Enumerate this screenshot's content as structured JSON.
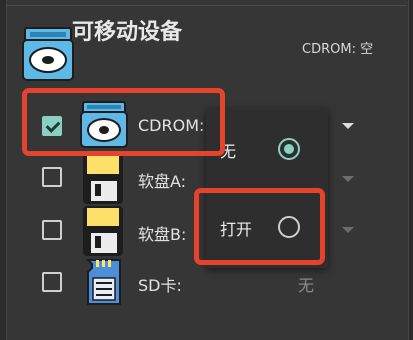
{
  "header": {
    "title": "可移动设备",
    "status": "CDROM: 空"
  },
  "devices": [
    {
      "label": "CDROM:",
      "checked": true,
      "icon": "cdrom-icon"
    },
    {
      "label": "软盘A:",
      "checked": false,
      "icon": "floppy-icon"
    },
    {
      "label": "软盘B:",
      "checked": false,
      "icon": "floppy-icon"
    },
    {
      "label": "SD卡:",
      "checked": false,
      "icon": "sd-card-icon",
      "value": "无"
    }
  ],
  "dropdown": {
    "options": [
      {
        "label": "无",
        "selected": true
      },
      {
        "label": "打开",
        "selected": false
      }
    ]
  },
  "colors": {
    "accent": "#8ad1c2",
    "highlight": "#e5432b",
    "background": "#363636"
  }
}
